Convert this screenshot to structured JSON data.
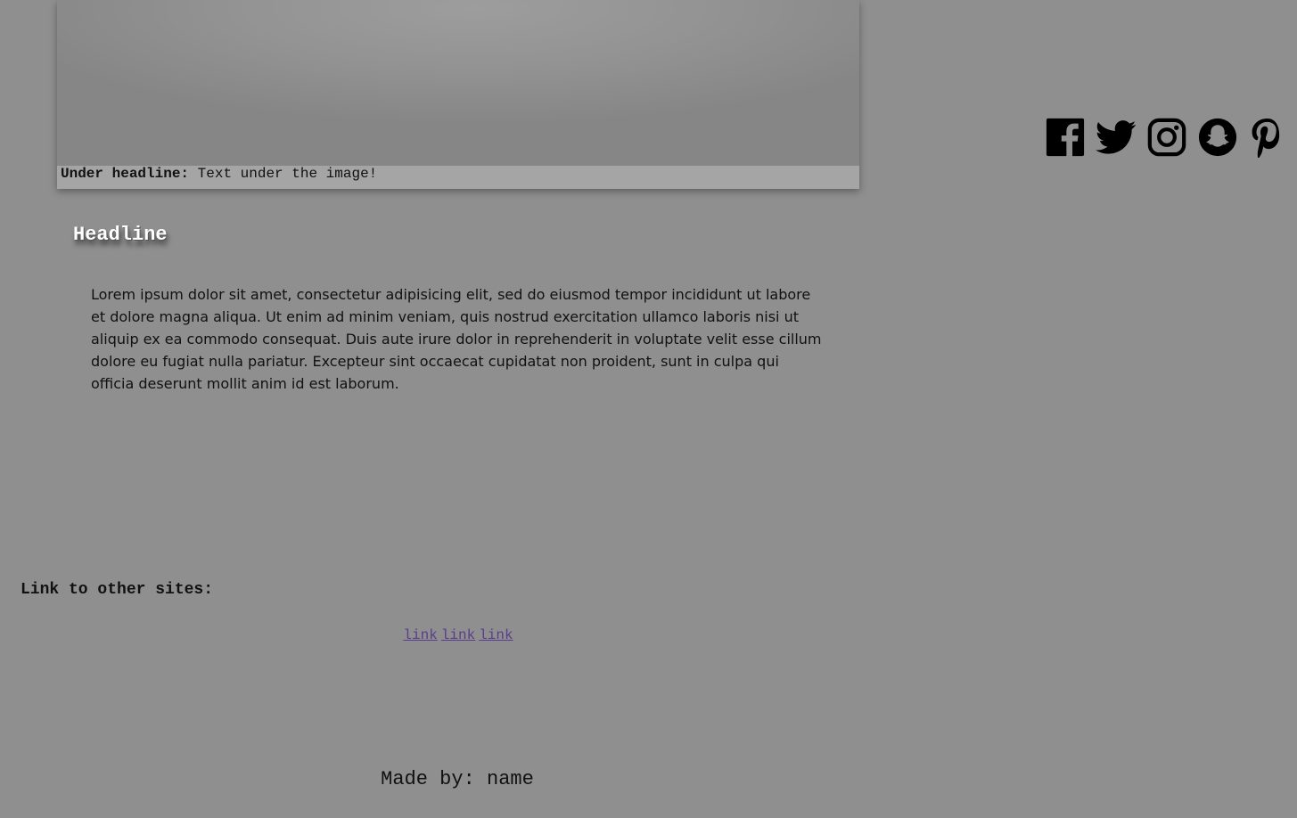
{
  "figure": {
    "caption_label": "Under headline:",
    "caption_text": "Text under the image!"
  },
  "headline": "Headline",
  "body_text": "Lorem ipsum dolor sit amet, consectetur adipisicing elit, sed do eiusmod tempor incididunt ut labore et dolore magna aliqua. Ut enim ad minim veniam, quis nostrud exercitation ullamco laboris nisi ut aliquip ex ea commodo consequat. Duis aute irure dolor in reprehenderit in voluptate velit esse cillum dolore eu fugiat nulla pariatur. Excepteur sint occaecat cupidatat non proident, sunt in culpa qui officia deserunt mollit anim id est laborum.",
  "social_icons": [
    "facebook-icon",
    "twitter-icon",
    "instagram-icon",
    "snapchat-icon",
    "pinterest-icon"
  ],
  "links": {
    "heading": "Link to other sites:",
    "items": [
      "link",
      "link",
      "link"
    ]
  },
  "footer": {
    "text": "Made by: name"
  },
  "colors": {
    "background": "#8f8f8f",
    "caption_bg": "#a5a5a5",
    "link": "#5a3e8c",
    "icon": "#000000"
  }
}
